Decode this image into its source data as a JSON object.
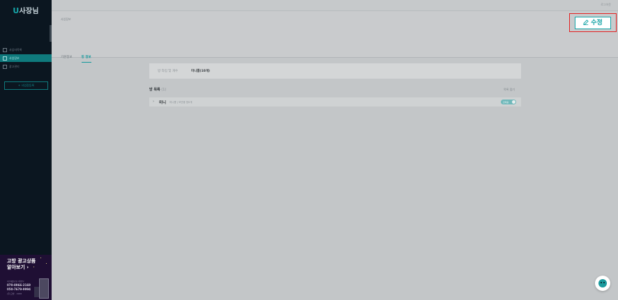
{
  "sidebar": {
    "logo_u": "U",
    "logo_text": "사장님",
    "menu": [
      {
        "label": "사업자목록",
        "icon": "list-icon",
        "active": false
      },
      {
        "label": "사업장보",
        "icon": "info-icon",
        "active": true
      },
      {
        "label": "광고관리",
        "icon": "ad-icon",
        "active": false
      }
    ],
    "add_button": "+ 사업장등록",
    "promo": {
      "title_line1": "고방 광고상품",
      "title_line2": "알아보기 ›",
      "sub": "사업개발팀 및 사업업무",
      "phone1": "070-8966-2169",
      "phone2": "050-7679-9994",
      "phone3": "(주)고방 · 1588"
    }
  },
  "topbar": {
    "right_text": "로그아웃"
  },
  "header": {
    "breadcrumb": "사업장보",
    "edit_button": "수정",
    "tabs": [
      {
        "label": "기본정보",
        "active": false
      },
      {
        "label": "방 정보",
        "active": true
      }
    ]
  },
  "room_info": {
    "label": "방 타입 및 개수",
    "value": "미니룸(10개)"
  },
  "room_list": {
    "title": "방 목록",
    "count": "(1)",
    "collapse_label": "목록 접기",
    "rows": [
      {
        "name": "미니",
        "meta": "미니룸 | 보관중 방0개",
        "toggle_label": "판매중"
      }
    ]
  },
  "colors": {
    "accent": "#13a3a6",
    "highlight": "#e32020",
    "sidebar": "#0b1620"
  }
}
